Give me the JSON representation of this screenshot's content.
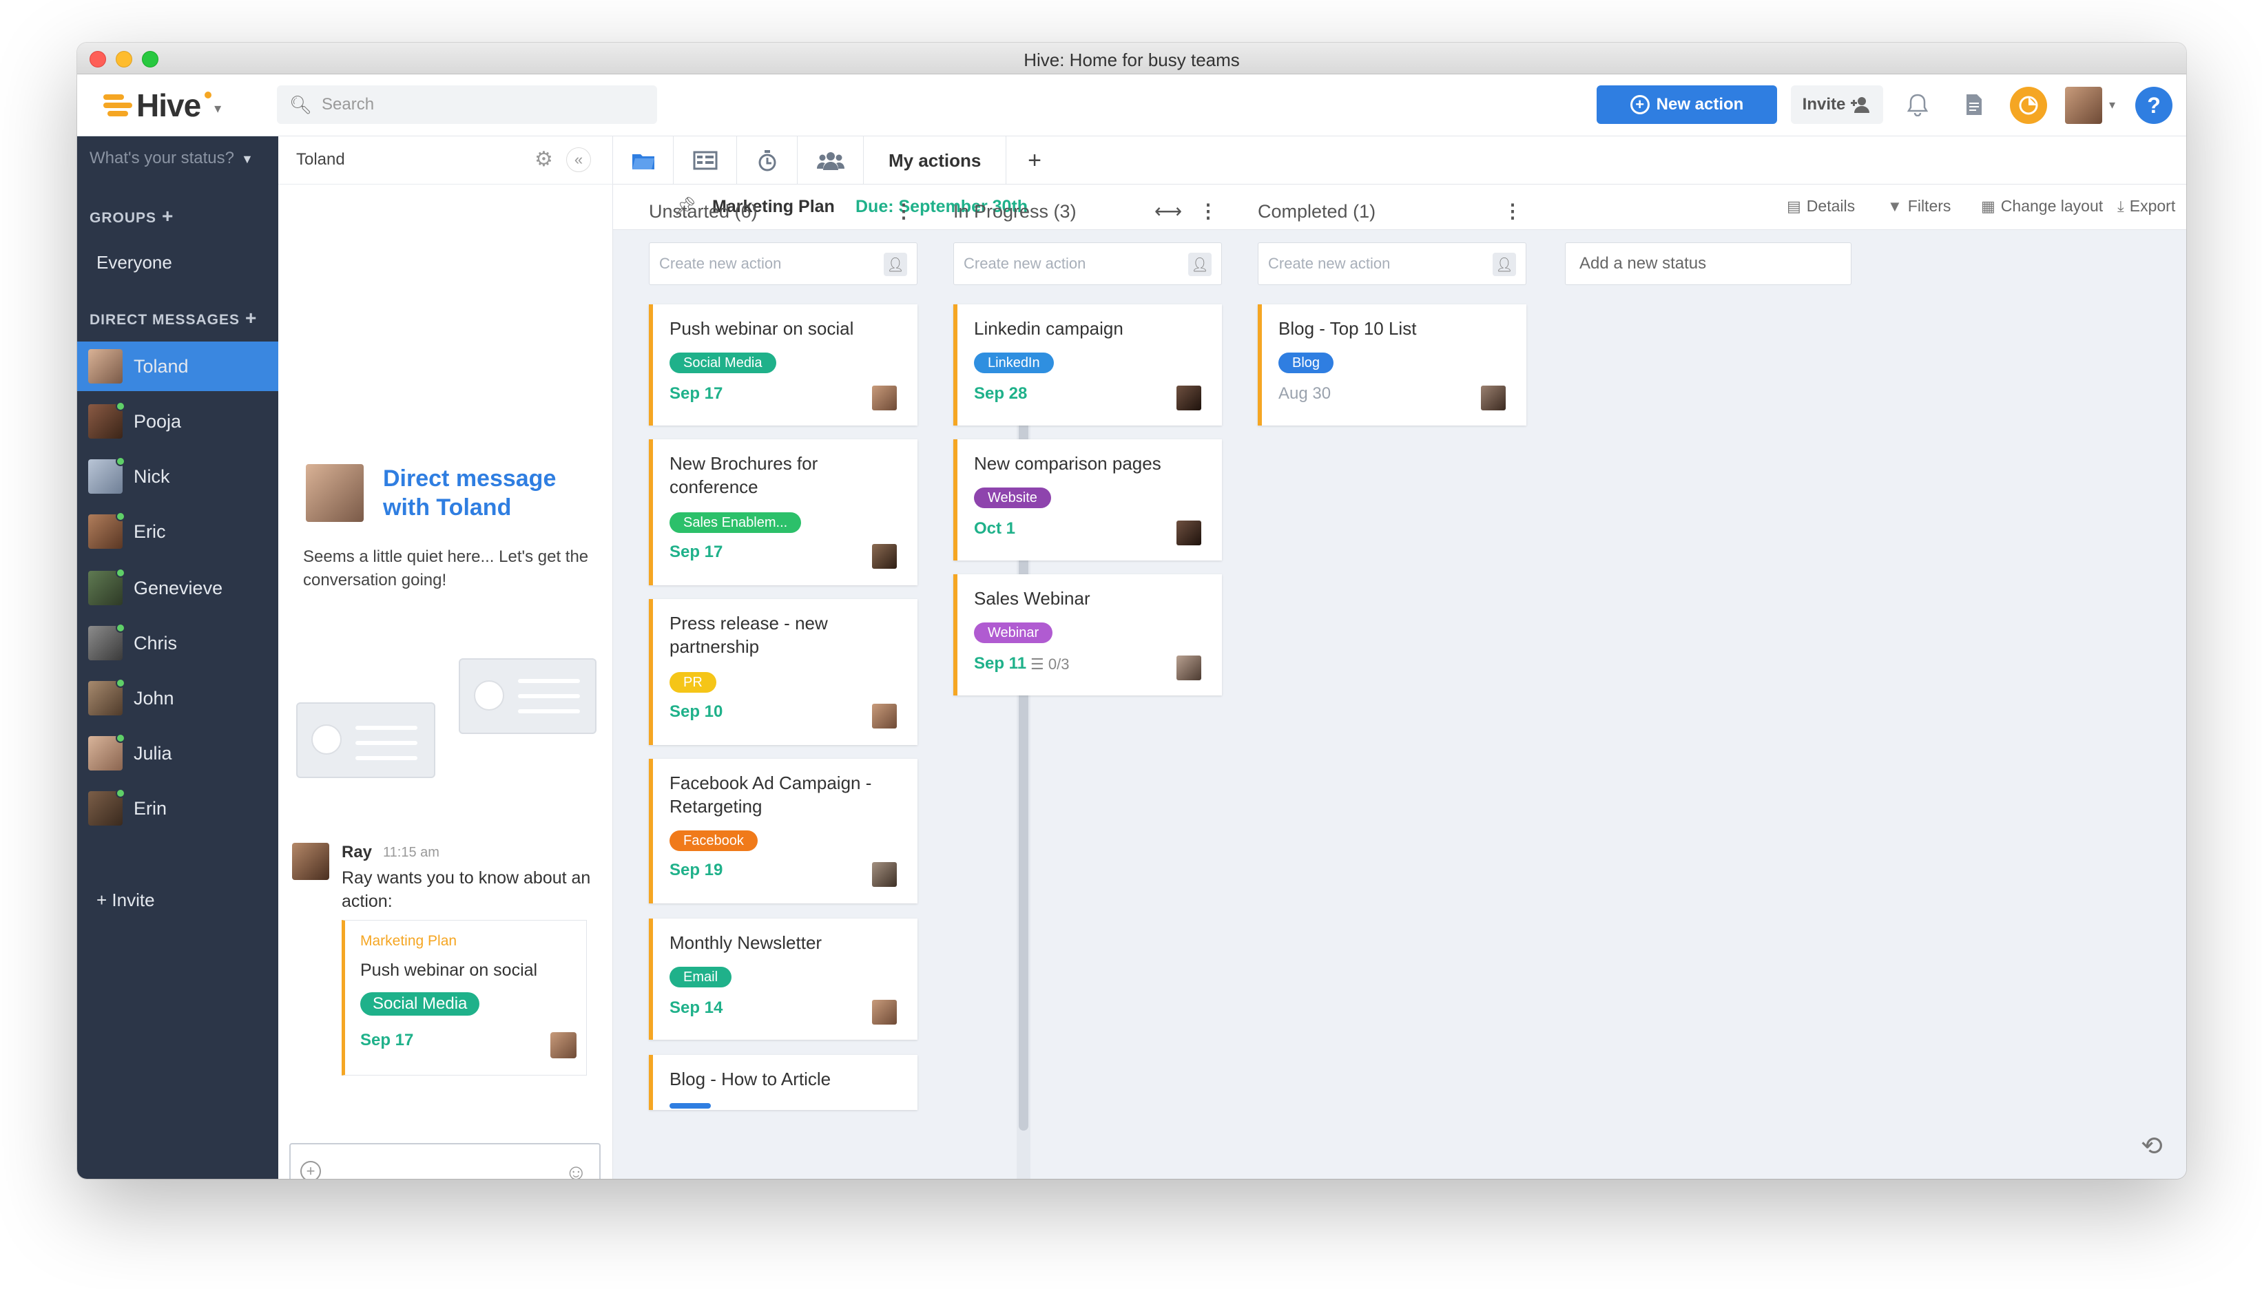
{
  "window": {
    "title": "Hive: Home for busy teams"
  },
  "topbar": {
    "logo": "Hive",
    "search_placeholder": "Search",
    "new_action_label": "New action",
    "invite_label": "Invite"
  },
  "sidebar": {
    "status_placeholder": "What's your status?",
    "groups_header": "GROUPS",
    "groups": [
      "Everyone"
    ],
    "dm_header": "DIRECT MESSAGES",
    "dms": [
      "Toland",
      "Pooja",
      "Nick",
      "Eric",
      "Genevieve",
      "Chris",
      "John",
      "Julia",
      "Erin"
    ],
    "active_dm": "Toland",
    "invite_label": "+ Invite"
  },
  "chat": {
    "header_name": "Toland",
    "dm_title": "Direct message with Toland",
    "empty_text": "Seems a little quiet here... Let's get the conversation going!",
    "message": {
      "sender": "Ray",
      "time": "11:15 am",
      "text": "Ray wants you to know about an action:",
      "attachment": {
        "project": "Marketing Plan",
        "title": "Push webinar on social",
        "tag": "Social Media",
        "date": "Sep 17"
      }
    }
  },
  "board": {
    "tab_label": "My actions",
    "project_name": "Marketing Plan",
    "due": "Due: September 30th",
    "options": {
      "details": "Details",
      "filters": "Filters",
      "layout": "Change layout",
      "export": "Export"
    },
    "create_placeholder": "Create new action",
    "add_status_placeholder": "Add a new status",
    "columns": [
      {
        "title": "Unstarted (6)",
        "cards": [
          {
            "title": "Push webinar on social",
            "tag": "Social Media",
            "tag_color": "#1fb18a",
            "date": "Sep 17",
            "date_color": "#1fb18a"
          },
          {
            "title": "New Brochures for conference",
            "tag": "Sales Enablem...",
            "tag_color": "#2cc06a",
            "date": "Sep 17",
            "date_color": "#1fb18a"
          },
          {
            "title": "Press release - new partnership",
            "tag": "PR",
            "tag_color": "#f5c518",
            "date": "Sep 10",
            "date_color": "#1fb18a"
          },
          {
            "title": "Facebook Ad Campaign - Retargeting",
            "tag": "Facebook",
            "tag_color": "#f07a1a",
            "date": "Sep 19",
            "date_color": "#1fb18a"
          },
          {
            "title": "Monthly Newsletter",
            "tag": "Email",
            "tag_color": "#1fb18a",
            "date": "Sep 14",
            "date_color": "#1fb18a"
          },
          {
            "title": "Blog - How to Article",
            "tag": "",
            "tag_color": "#2f7ee1",
            "date": "",
            "date_color": "#1fb18a"
          }
        ]
      },
      {
        "title": "In Progress (3)",
        "cards": [
          {
            "title": "Linkedin campaign",
            "tag": "LinkedIn",
            "tag_color": "#2f8fe0",
            "date": "Sep 28",
            "date_color": "#1fb18a"
          },
          {
            "title": "New comparison pages",
            "tag": "Website",
            "tag_color": "#8e44ad",
            "date": "Oct 1",
            "date_color": "#1fb18a"
          },
          {
            "title": "Sales Webinar",
            "tag": "Webinar",
            "tag_color": "#b05bd1",
            "date": "Sep 11",
            "date_color": "#1fb18a",
            "checklist": "0/3"
          }
        ]
      },
      {
        "title": "Completed (1)",
        "cards": [
          {
            "title": "Blog - Top 10 List",
            "tag": "Blog",
            "tag_color": "#2f7ee1",
            "date": "Aug 30",
            "date_color": "#9aa2ad"
          }
        ]
      }
    ]
  }
}
